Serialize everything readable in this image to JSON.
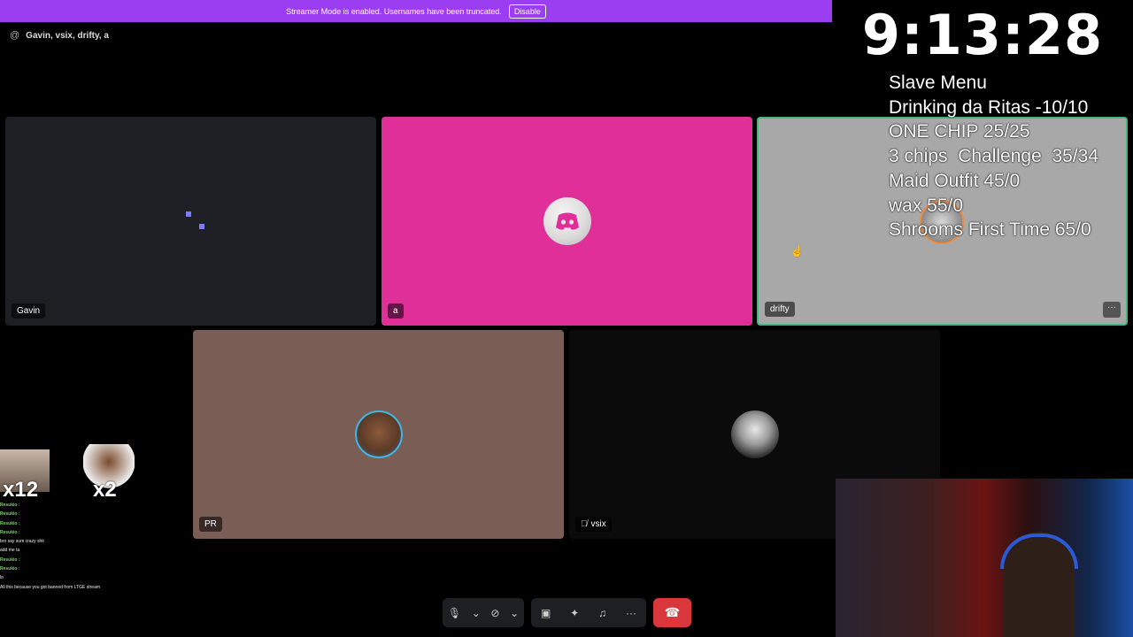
{
  "banner": {
    "message": "Streamer Mode is enabled. Usernames have been truncated.",
    "disable_label": "Disable"
  },
  "channel": {
    "icon": "at-icon",
    "title": "Gavin, vsix, drifty, a"
  },
  "participants": [
    {
      "name": "Gavin",
      "background": "#1e1f24"
    },
    {
      "name": "a",
      "background": "#e12f9a"
    },
    {
      "name": "drifty",
      "background": "#a8a8a8"
    },
    {
      "name": "PR",
      "background": "#7a5e55"
    },
    {
      "name": "vsix",
      "background": "#0b0b0b",
      "muted": true
    }
  ],
  "timer": "9:13:28",
  "menu": {
    "title": "Slave Menu",
    "items": [
      "Drinking da Ritas -10/10",
      "ONE CHIP 25/25",
      "3 chips  Challenge  35/34",
      "Maid Outfit 45/0",
      "wax 55/0",
      "Shrooms First Time 65/0"
    ]
  },
  "emotes": [
    {
      "label": "x12"
    },
    {
      "label": "x2"
    }
  ],
  "chat": [
    {
      "user": "Resukio",
      "text": "",
      "color": "#7ad36b"
    },
    {
      "user": "Resukio",
      "text": "",
      "color": "#7ad36b"
    },
    {
      "user": "Resukio",
      "text": "",
      "color": "#7ad36b"
    },
    {
      "user": "Resukio",
      "text": "",
      "color": "#7ad36b"
    },
    {
      "user": "",
      "text": "bro say sum crazy shit",
      "color": "#e0507a"
    },
    {
      "user": "",
      "text": "add me ta",
      "color": "#5aa0e6"
    },
    {
      "user": "Resukio",
      "text": "",
      "color": "#7ad36b"
    },
    {
      "user": "Resukio",
      "text": "",
      "color": "#7ad36b"
    },
    {
      "user": "",
      "text": "",
      "color": "#e05050"
    },
    {
      "user": "",
      "text": "",
      "color": "#e05050"
    },
    {
      "user": "",
      "text": "",
      "color": "#e05050"
    },
    {
      "user": "",
      "text": "lo",
      "color": "#e07030"
    },
    {
      "user": "",
      "text": "",
      "color": "#e05050"
    },
    {
      "user": "",
      "text": "",
      "color": "#5aa0e6"
    },
    {
      "user": "",
      "text": "All this because you got banned from LTGE stream",
      "color": "#aaaaaa"
    }
  ],
  "colors": {
    "banner": "#9b3df0",
    "hangup": "#da373c",
    "speaking_border": "#43b581"
  }
}
